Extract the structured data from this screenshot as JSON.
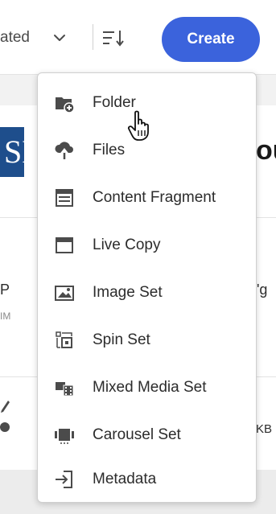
{
  "toolbar": {
    "sort_label": "ated",
    "create_label": "Create",
    "create_color": "#3b63dc"
  },
  "background": {
    "thumb_text": "SH",
    "title_fragment": "ou",
    "row1_name_fragment": "P",
    "row1_meta_fragment": "IM",
    "row1_ext_fragment": "'g",
    "row2_size_fragment": "KB"
  },
  "menu": {
    "items": [
      {
        "label": "Folder",
        "icon": "folder-add-icon"
      },
      {
        "label": "Files",
        "icon": "cloud-upload-icon"
      },
      {
        "label": "Content Fragment",
        "icon": "content-fragment-icon"
      },
      {
        "label": "Live Copy",
        "icon": "live-copy-icon"
      },
      {
        "label": "Image Set",
        "icon": "image-set-icon"
      },
      {
        "label": "Spin Set",
        "icon": "spin-set-icon"
      },
      {
        "label": "Mixed Media Set",
        "icon": "mixed-media-set-icon"
      },
      {
        "label": "Carousel Set",
        "icon": "carousel-set-icon"
      },
      {
        "label": "Metadata",
        "icon": "metadata-import-icon"
      }
    ]
  },
  "cursor": "hand-pointer-icon"
}
